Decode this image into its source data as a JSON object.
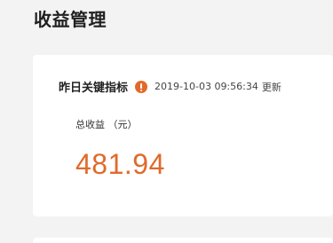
{
  "header": {
    "title": "收益管理"
  },
  "kpi_card": {
    "title": "昨日关键指标",
    "info_icon": "info-icon",
    "update_time": "2019-10-03 09:56:34",
    "update_suffix": "更新",
    "metric": {
      "label": "总收益 （元）",
      "value": "481.94"
    }
  },
  "colors": {
    "accent": "#e06a2b",
    "background": "#f3f3f3",
    "card": "#ffffff"
  }
}
